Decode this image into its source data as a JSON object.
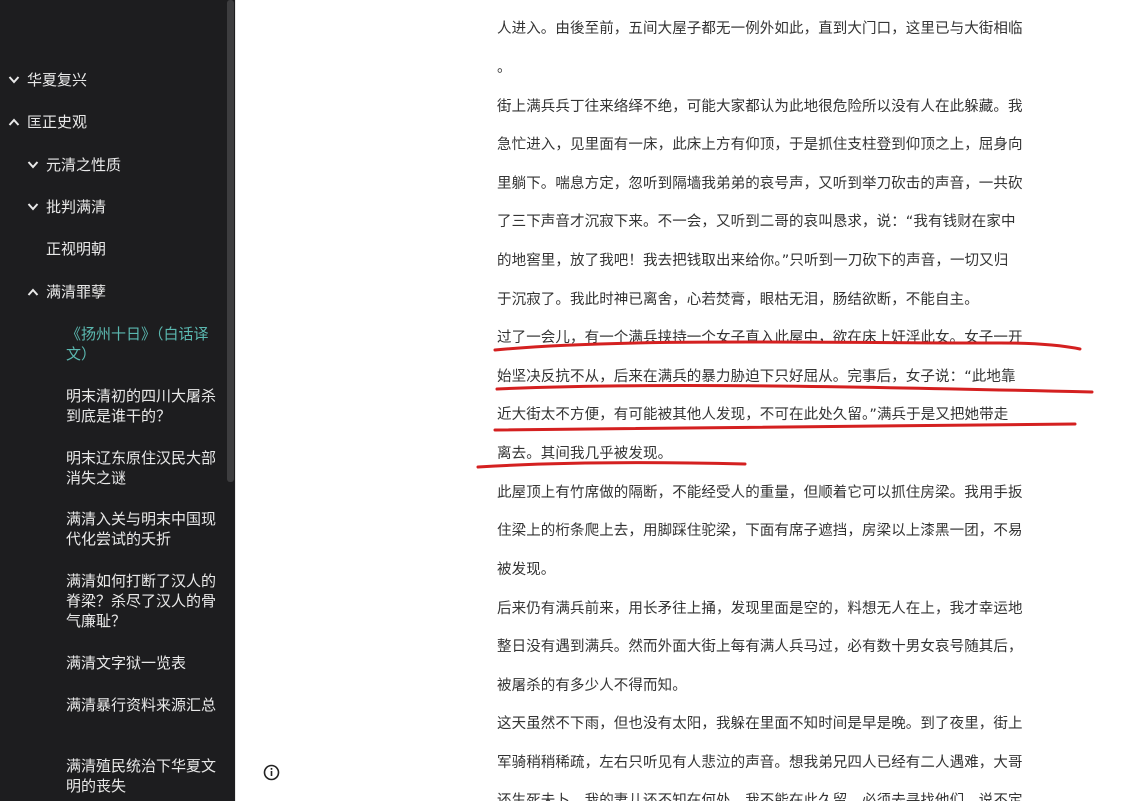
{
  "sidebar": {
    "items": [
      {
        "label": "华夏复兴",
        "chevron": "down"
      },
      {
        "label": "匡正史观",
        "chevron": "up"
      },
      {
        "label": "元清之性质",
        "chevron": "down"
      },
      {
        "label": "批判满清",
        "chevron": "down"
      },
      {
        "label": "正视明朝",
        "chevron": ""
      },
      {
        "label": "满清罪孽",
        "chevron": "up"
      },
      {
        "label": "《扬州十日》（白话译文）",
        "chevron": ""
      },
      {
        "label": "明末清初的四川大屠杀到底是谁干的？",
        "chevron": ""
      },
      {
        "label": "明末辽东原住汉民大部消失之谜",
        "chevron": ""
      },
      {
        "label": "满清入关与明末中国现代化尝试的夭折",
        "chevron": ""
      },
      {
        "label": "满清如何打断了汉人的脊梁？杀尽了汉人的骨气廉耻？",
        "chevron": ""
      },
      {
        "label": "满清文字狱一览表",
        "chevron": ""
      },
      {
        "label": "满清暴行资料来源汇总",
        "chevron": ""
      },
      {
        "label": "满清殖民统治下华夏文明的丧失",
        "chevron": ""
      }
    ]
  },
  "info_icon": "info-circle-icon",
  "article": {
    "lines": [
      "人进入。由後至前，五间大屋子都无一例外如此，直到大门口，这里已与大街相临",
      "。",
      "街上满兵兵丁往来络绎不绝，可能大家都认为此地很危险所以没有人在此躲藏。我",
      "急忙进入，见里面有一床，此床上方有仰顶，于是抓住支柱登到仰顶之上，屈身向",
      "里躺下。喘息方定，忽听到隔墙我弟弟的哀号声，又听到举刀砍击的声音，一共砍",
      "了三下声音才沉寂下来。不一会，又听到二哥的哀叫恳求，说：“我有钱财在家中",
      "的地窖里，放了我吧！我去把钱取出来给你。”只听到一刀砍下的声音，一切又归",
      "于沉寂了。我此时神已离舍，心若焚膏，眼枯无泪，肠结欲断，不能自主。",
      "过了一会儿，有一个满兵挟持一个女子直入此屋中，欲在床上奸淫此女。女子一开",
      "始坚决反抗不从，后来在满兵的暴力胁迫下只好屈从。完事后，女子说：“此地靠",
      "近大街太不方便，有可能被其他人发现，不可在此处久留。”满兵于是又把她带走",
      "离去。其间我几乎被发现。",
      "此屋顶上有竹席做的隔断，不能经受人的重量，但顺着它可以抓住房梁。我用手扳",
      "住梁上的桁条爬上去，用脚踩住驼梁，下面有席子遮挡，房梁以上漆黑一团，不易",
      "被发现。",
      "后来仍有满兵前来，用长矛往上捅，发现里面是空的，料想无人在上，我才幸运地",
      "整日没有遇到满兵。然而外面大街上每有满人兵马过，必有数十男女哀号随其后，",
      "被屠杀的有多少人不得而知。",
      "这天虽然不下雨，但也没有太阳，我躲在里面不知时间是早是晚。到了夜里，街上",
      "军骑稍稍稀疏，左右只听见有人悲泣的声音。想我弟兄四人已经有二人遇难，大哥",
      "还生死未卜，我的妻儿还不知在何处。我不能在此久留，必须去寻找他们，说不定"
    ]
  },
  "colors": {
    "sidebar_bg": "#1d1d1f",
    "active_link": "#5bb8b0",
    "annotation_red": "#d42020"
  }
}
